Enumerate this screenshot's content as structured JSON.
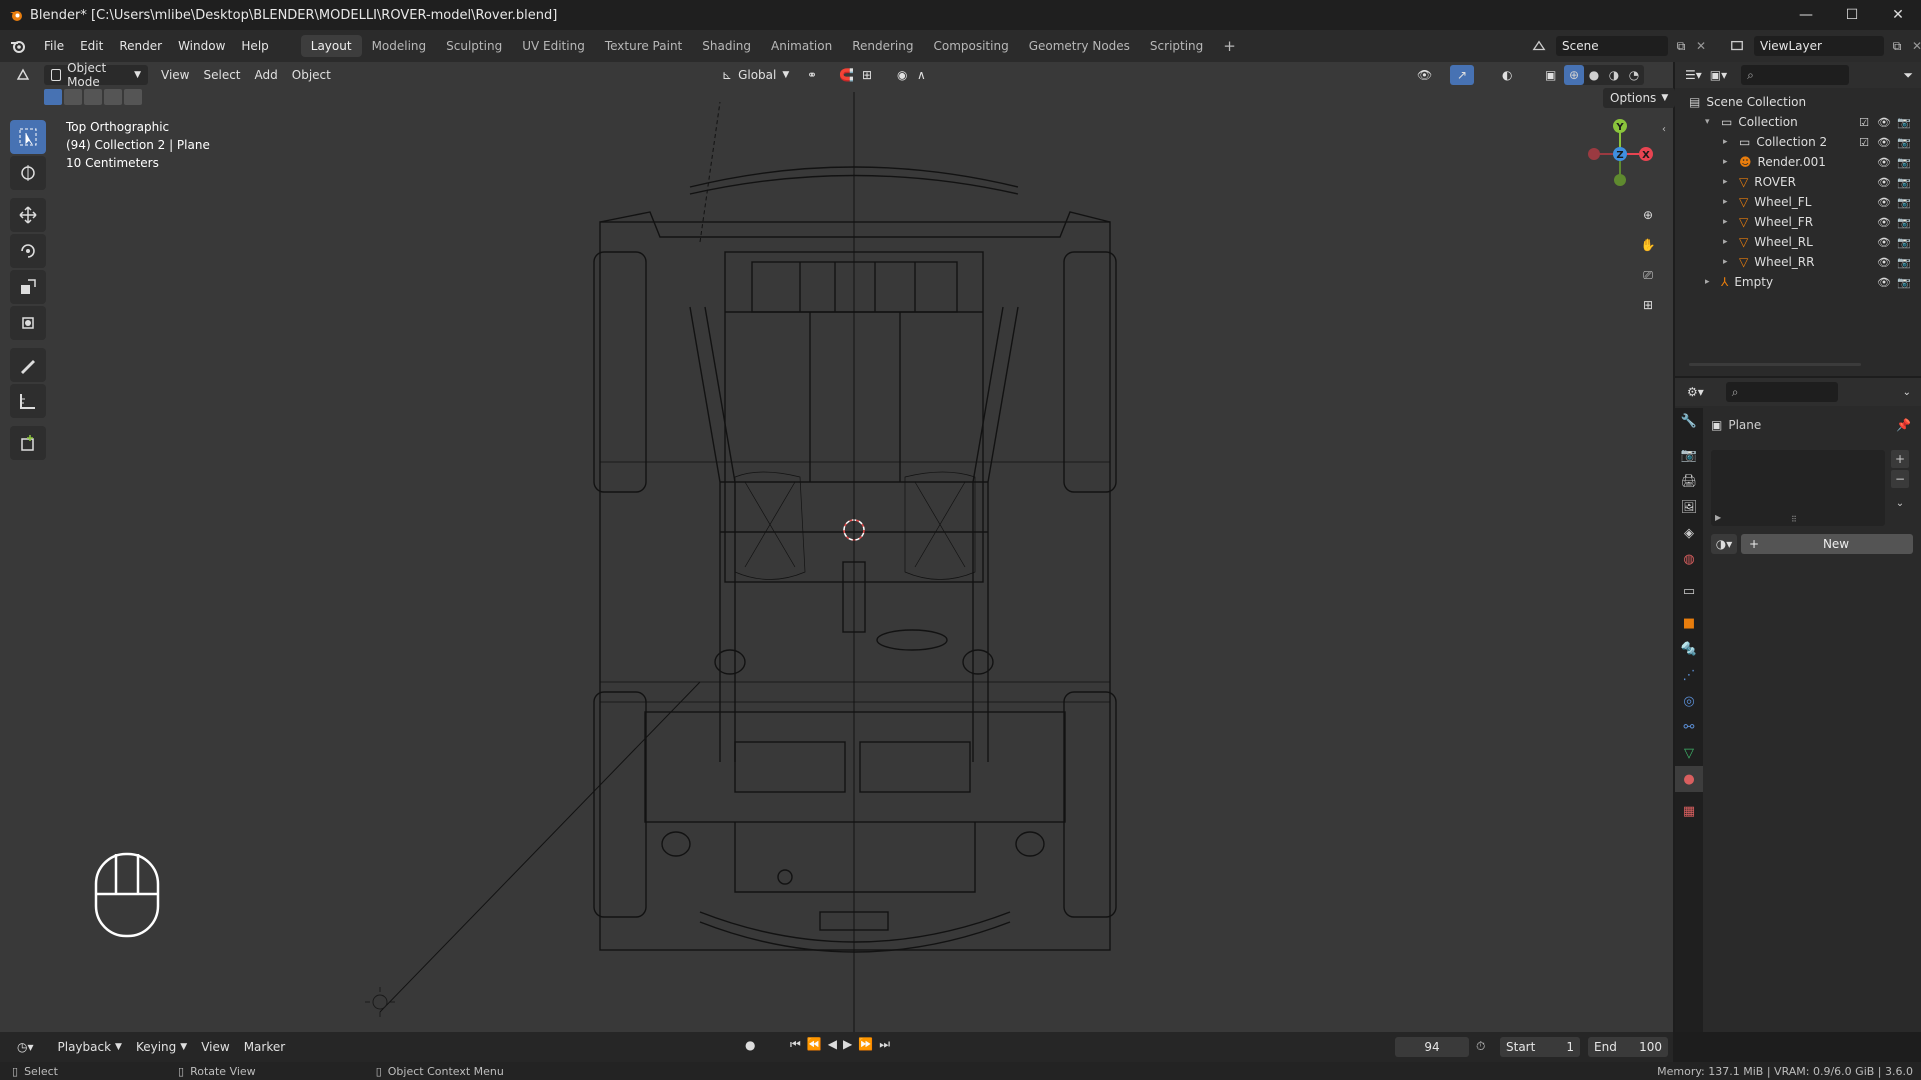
{
  "titlebar": {
    "title": "Blender* [C:\\Users\\mlibe\\Desktop\\BLENDER\\MODELLI\\ROVER-model\\Rover.blend]",
    "minimize": "—",
    "maximize": "☐",
    "close": "✕"
  },
  "menubar": {
    "menus": [
      "File",
      "Edit",
      "Render",
      "Window",
      "Help"
    ],
    "workspaces": [
      "Layout",
      "Modeling",
      "Sculpting",
      "UV Editing",
      "Texture Paint",
      "Shading",
      "Animation",
      "Rendering",
      "Compositing",
      "Geometry Nodes",
      "Scripting"
    ],
    "add_workspace": "+",
    "active_workspace": "Layout",
    "scene": "Scene",
    "view_layer": "ViewLayer"
  },
  "viewport_header": {
    "mode": "Object Mode",
    "menus": [
      "View",
      "Select",
      "Add",
      "Object"
    ],
    "orientation": "Global",
    "options": "Options"
  },
  "viewport_info": {
    "view": "Top Orthographic",
    "collection": "(94) Collection 2 | Plane",
    "scale": "10 Centimeters"
  },
  "gizmo": {
    "y": "Y",
    "z": "Z",
    "x": "X"
  },
  "outliner": {
    "root": "Scene Collection",
    "items": [
      {
        "label": "Collection",
        "depth": 1,
        "kind": "collection"
      },
      {
        "label": "Collection 2",
        "depth": 2,
        "kind": "collection"
      },
      {
        "label": "Render.001",
        "depth": 2,
        "kind": "armature"
      },
      {
        "label": "ROVER",
        "depth": 2,
        "kind": "mesh"
      },
      {
        "label": "Wheel_FL",
        "depth": 2,
        "kind": "mesh"
      },
      {
        "label": "Wheel_FR",
        "depth": 2,
        "kind": "mesh"
      },
      {
        "label": "Wheel_RL",
        "depth": 2,
        "kind": "mesh"
      },
      {
        "label": "Wheel_RR",
        "depth": 2,
        "kind": "mesh"
      },
      {
        "label": "Empty",
        "depth": 1,
        "kind": "empty"
      }
    ]
  },
  "properties": {
    "object_name": "Plane",
    "new_button": "New",
    "new_plus": "+"
  },
  "timeline": {
    "menus": [
      "Playback",
      "Keying",
      "View",
      "Marker"
    ],
    "current_frame": "94",
    "start_label": "Start",
    "start_value": "1",
    "end_label": "End",
    "end_value": "100"
  },
  "statusbar": {
    "select": "Select",
    "rotate": "Rotate View",
    "context_menu": "Object Context Menu",
    "memory": "Memory: 137.1 MiB | VRAM: 0.9/6.0 GiB | 3.6.0"
  },
  "colors": {
    "accent": "#4772b3",
    "viewport_bg": "#393939",
    "wire": "#111111",
    "gizmo_x": "#e84451",
    "gizmo_y": "#8ac43c",
    "gizmo_z": "#3f8fe0"
  }
}
